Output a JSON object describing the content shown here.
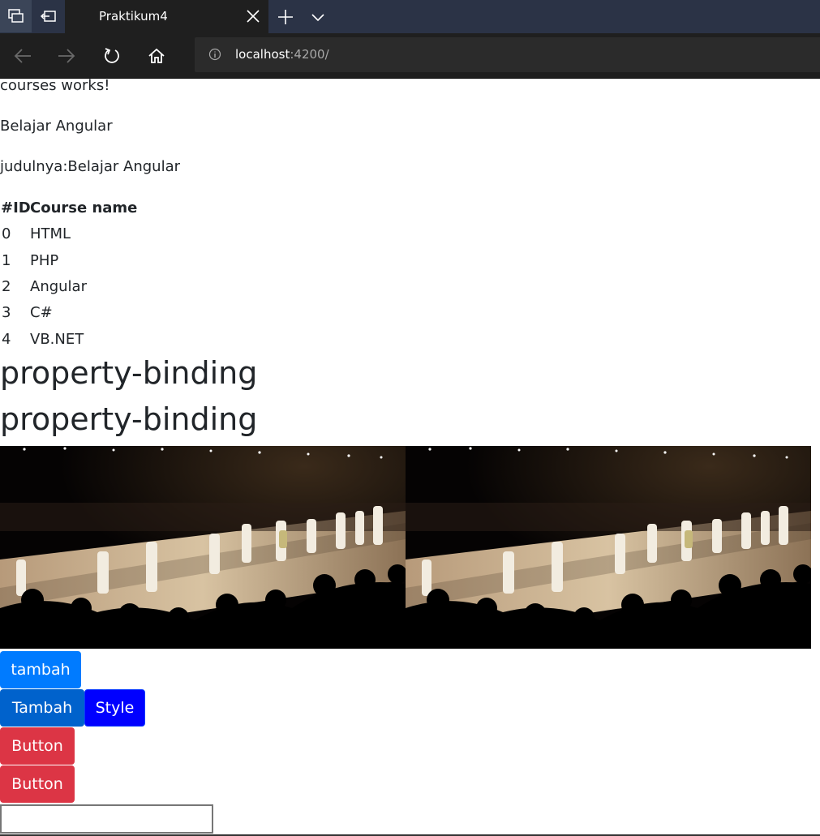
{
  "browser": {
    "tab_title": "Praktikum4",
    "url_host": "localhost",
    "url_rest": ":4200/"
  },
  "page": {
    "line1": "courses works!",
    "line2": "Belajar Angular",
    "line3": "judulnya:Belajar Angular",
    "table": {
      "headers": [
        "#ID",
        "Course name"
      ],
      "rows": [
        {
          "id": "0",
          "name": "HTML"
        },
        {
          "id": "1",
          "name": "PHP"
        },
        {
          "id": "2",
          "name": "Angular"
        },
        {
          "id": "3",
          "name": "C#"
        },
        {
          "id": "4",
          "name": "VB.NET"
        }
      ]
    },
    "heading1": "property-binding",
    "heading2": "property-binding",
    "buttons": {
      "tambah_lower": "tambah",
      "tambah_upper": "Tambah",
      "style": "Style",
      "button1": "Button",
      "button2": "Button"
    },
    "input_value": ""
  },
  "colors": {
    "primary": "#007bff",
    "primary_dark": "#0062cc",
    "style_blue": "#0000ff",
    "danger": "#dc3545"
  }
}
